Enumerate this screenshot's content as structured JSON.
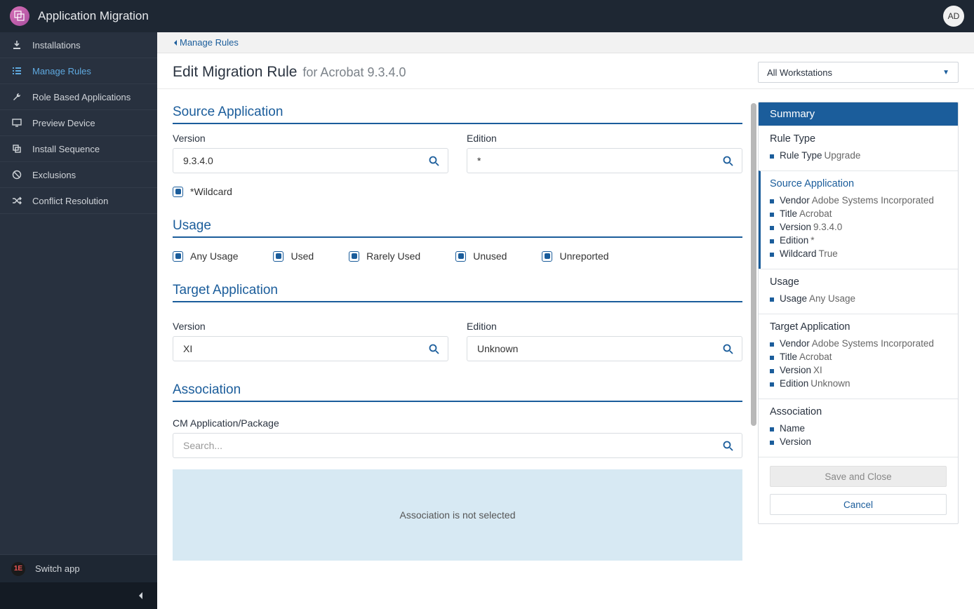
{
  "app": {
    "title": "Application Migration",
    "avatar": "AD"
  },
  "sidebar": {
    "items": [
      {
        "label": "Installations"
      },
      {
        "label": "Manage Rules"
      },
      {
        "label": "Role Based Applications"
      },
      {
        "label": "Preview Device"
      },
      {
        "label": "Install Sequence"
      },
      {
        "label": "Exclusions"
      },
      {
        "label": "Conflict Resolution"
      }
    ],
    "active_index": 1,
    "switch_label": "Switch app"
  },
  "breadcrumb": {
    "back_label": "Manage Rules"
  },
  "header": {
    "title": "Edit Migration Rule",
    "subtitle": "for Acrobat 9.3.4.0",
    "dropdown_value": "All Workstations"
  },
  "source": {
    "section": "Source Application",
    "version_label": "Version",
    "version_value": "9.3.4.0",
    "edition_label": "Edition",
    "edition_value": "*",
    "wildcard_label": "*Wildcard"
  },
  "usage": {
    "section": "Usage",
    "options": [
      "Any Usage",
      "Used",
      "Rarely Used",
      "Unused",
      "Unreported"
    ]
  },
  "target": {
    "section": "Target Application",
    "version_label": "Version",
    "version_value": "XI",
    "edition_label": "Edition",
    "edition_value": "Unknown"
  },
  "association": {
    "section": "Association",
    "field_label": "CM Application/Package",
    "placeholder": "Search...",
    "empty_text": "Association is not selected"
  },
  "summary": {
    "title": "Summary",
    "groups": {
      "rule_type": {
        "title": "Rule Type",
        "lines": [
          {
            "k": "Rule Type",
            "v": "Upgrade"
          }
        ]
      },
      "source": {
        "title": "Source Application",
        "lines": [
          {
            "k": "Vendor",
            "v": "Adobe Systems Incorporated"
          },
          {
            "k": "Title",
            "v": "Acrobat"
          },
          {
            "k": "Version",
            "v": "9.3.4.0"
          },
          {
            "k": "Edition",
            "v": "*"
          },
          {
            "k": "Wildcard",
            "v": "True"
          }
        ]
      },
      "usage": {
        "title": "Usage",
        "lines": [
          {
            "k": "Usage",
            "v": "Any Usage"
          }
        ]
      },
      "target": {
        "title": "Target Application",
        "lines": [
          {
            "k": "Vendor",
            "v": "Adobe Systems Incorporated"
          },
          {
            "k": "Title",
            "v": "Acrobat"
          },
          {
            "k": "Version",
            "v": "XI"
          },
          {
            "k": "Edition",
            "v": "Unknown"
          }
        ]
      },
      "association": {
        "title": "Association",
        "lines": [
          {
            "k": "Name",
            "v": ""
          },
          {
            "k": "Version",
            "v": ""
          }
        ]
      }
    },
    "buttons": {
      "save": "Save and Close",
      "cancel": "Cancel"
    }
  }
}
